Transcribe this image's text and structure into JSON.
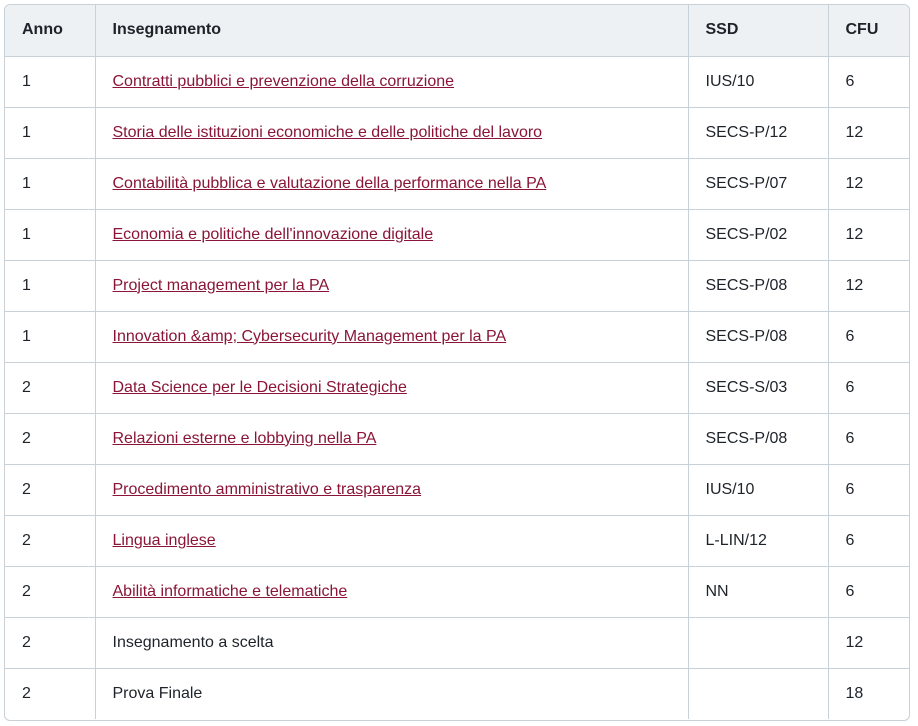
{
  "table": {
    "headers": {
      "anno": "Anno",
      "insegnamento": "Insegnamento",
      "ssd": "SSD",
      "cfu": "CFU"
    },
    "rows": [
      {
        "anno": "1",
        "insegnamento": "Contratti pubblici e prevenzione della corruzione",
        "ssd": "IUS/10",
        "cfu": "6",
        "link": true
      },
      {
        "anno": "1",
        "insegnamento": "Storia delle istituzioni economiche e delle politiche del lavoro",
        "ssd": "SECS-P/12",
        "cfu": "12",
        "link": true
      },
      {
        "anno": "1",
        "insegnamento": "Contabilità pubblica e valutazione della performance nella PA",
        "ssd": "SECS-P/07",
        "cfu": "12",
        "link": true
      },
      {
        "anno": "1",
        "insegnamento": "Economia e politiche dell'innovazione digitale",
        "ssd": "SECS-P/02",
        "cfu": "12",
        "link": true
      },
      {
        "anno": "1",
        "insegnamento": "Project management per la PA",
        "ssd": "SECS-P/08",
        "cfu": "12",
        "link": true
      },
      {
        "anno": "1",
        "insegnamento": "Innovation &amp; Cybersecurity Management per la PA",
        "ssd": "SECS-P/08",
        "cfu": "6",
        "link": true
      },
      {
        "anno": "2",
        "insegnamento": "Data Science per le Decisioni Strategiche",
        "ssd": "SECS-S/03",
        "cfu": "6",
        "link": true
      },
      {
        "anno": "2",
        "insegnamento": "Relazioni esterne e lobbying nella PA",
        "ssd": "SECS-P/08",
        "cfu": "6",
        "link": true
      },
      {
        "anno": "2",
        "insegnamento": "Procedimento amministrativo e trasparenza",
        "ssd": "IUS/10",
        "cfu": "6",
        "link": true
      },
      {
        "anno": "2",
        "insegnamento": "Lingua inglese",
        "ssd": "L-LIN/12",
        "cfu": "6",
        "link": true
      },
      {
        "anno": "2",
        "insegnamento": "Abilità informatiche e telematiche ",
        "ssd": "NN",
        "cfu": "6",
        "link": true
      },
      {
        "anno": "2",
        "insegnamento": "Insegnamento a scelta",
        "ssd": "",
        "cfu": "12",
        "link": false
      },
      {
        "anno": "2",
        "insegnamento": "Prova Finale",
        "ssd": "",
        "cfu": "18",
        "link": false
      }
    ]
  },
  "colors": {
    "link": "#8a1538",
    "header_bg": "#eef1f4",
    "border": "#c8d0d8",
    "text": "#1e2329"
  }
}
